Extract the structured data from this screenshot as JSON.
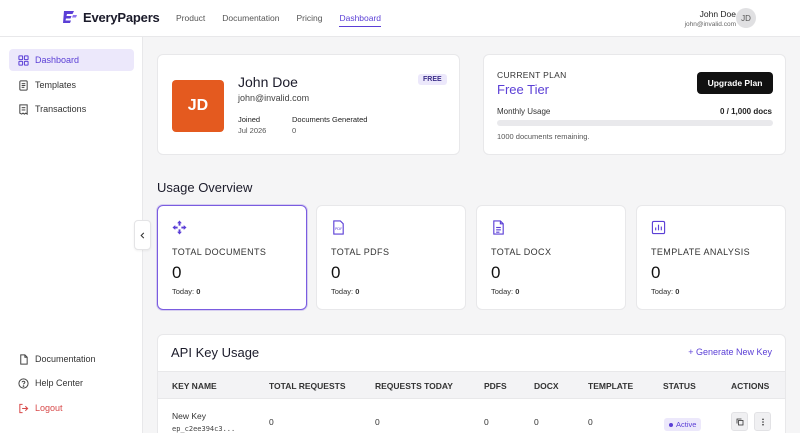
{
  "app": {
    "name": "EveryPapers"
  },
  "nav": {
    "items": [
      "Product",
      "Documentation",
      "Pricing",
      "Dashboard"
    ],
    "active": "Dashboard"
  },
  "user": {
    "name": "John Doe",
    "email": "john@invalid.com",
    "initials": "JD"
  },
  "sidebar": {
    "items": [
      {
        "label": "Dashboard",
        "icon": "grid-icon",
        "active": true
      },
      {
        "label": "Templates",
        "icon": "document-icon"
      },
      {
        "label": "Transactions",
        "icon": "receipt-icon"
      }
    ],
    "bottom": [
      {
        "label": "Documentation",
        "icon": "file-icon"
      },
      {
        "label": "Help Center",
        "icon": "help-circle-icon"
      },
      {
        "label": "Logout",
        "icon": "logout-icon"
      }
    ]
  },
  "profile": {
    "initials": "JD",
    "name": "John Doe",
    "email": "john@invalid.com",
    "tier_badge": "FREE",
    "joined_label": "Joined",
    "joined_value": "Jul 2026",
    "docs_label": "Documents Generated",
    "docs_value": "0"
  },
  "plan": {
    "label": "CURRENT PLAN",
    "name": "Free Tier",
    "upgrade_label": "Upgrade Plan",
    "usage_label": "Monthly Usage",
    "usage_count": "0 / 1,000 docs",
    "usage_fraction": 0,
    "remaining": "1000 documents remaining."
  },
  "usage": {
    "title": "Usage Overview",
    "today_label": "Today:",
    "cards": [
      {
        "label": "TOTAL DOCUMENTS",
        "value": "0",
        "today": "0",
        "icon": "move-arrows-icon"
      },
      {
        "label": "TOTAL PDFS",
        "value": "0",
        "today": "0",
        "icon": "pdf-file-icon"
      },
      {
        "label": "TOTAL DOCX",
        "value": "0",
        "today": "0",
        "icon": "docx-file-icon"
      },
      {
        "label": "TEMPLATE ANALYSIS",
        "value": "0",
        "today": "0",
        "icon": "bar-chart-icon"
      }
    ]
  },
  "api": {
    "title": "API Key Usage",
    "generate_label": "+ Generate New Key",
    "columns": [
      "KEY NAME",
      "TOTAL REQUESTS",
      "REQUESTS TODAY",
      "PDFS",
      "DOCX",
      "TEMPLATE",
      "STATUS",
      "ACTIONS"
    ],
    "rows": [
      {
        "name": "New Key",
        "key_id": "ep_c2ee394c3...",
        "total_requests": "0",
        "requests_today": "0",
        "pdfs": "0",
        "docx": "0",
        "template": "0",
        "status": "Active"
      }
    ]
  },
  "colors": {
    "accent": "#5b3fd6",
    "avatar_bg": "#e45a1f",
    "logout": "#d84a4a"
  }
}
